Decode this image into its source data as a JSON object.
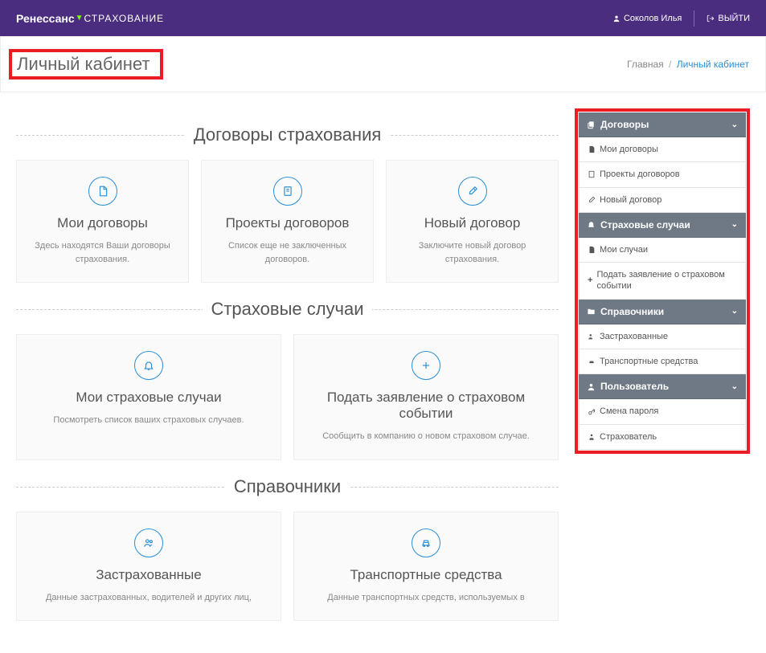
{
  "header": {
    "logo_bold": "Ренессанс",
    "logo_thin": "СТРАХОВАНИЕ",
    "user_name": "Соколов Илья",
    "logout": "ВЫЙТИ"
  },
  "page": {
    "title": "Личный кабинет",
    "breadcrumb_home": "Главная",
    "breadcrumb_current": "Личный кабинет"
  },
  "sections": {
    "contracts": {
      "title": "Договоры страхования",
      "cards": [
        {
          "title": "Мои договоры",
          "desc": "Здесь находятся Ваши договоры страхования."
        },
        {
          "title": "Проекты договоров",
          "desc": "Список еще не заключенных договоров."
        },
        {
          "title": "Новый договор",
          "desc": "Заключите новый договор страхования."
        }
      ]
    },
    "cases": {
      "title": "Страховые случаи",
      "cards": [
        {
          "title": "Мои страховые случаи",
          "desc": "Посмотреть список ваших страховых случаев."
        },
        {
          "title": "Подать заявление о страховом событии",
          "desc": "Сообщить в компанию о новом страховом случае."
        }
      ]
    },
    "references": {
      "title": "Справочники",
      "cards": [
        {
          "title": "Застрахованные",
          "desc": "Данные застрахованных, водителей и других лиц,"
        },
        {
          "title": "Транспортные средства",
          "desc": "Данные транспортных средств, используемых в"
        }
      ]
    }
  },
  "sidebar": {
    "groups": [
      {
        "title": "Договоры",
        "items": [
          "Мои договоры",
          "Проекты договоров",
          "Новый договор"
        ]
      },
      {
        "title": "Страховые случаи",
        "items": [
          "Мои случаи",
          "Подать заявление о страховом событии"
        ]
      },
      {
        "title": "Справочники",
        "items": [
          "Застрахованные",
          "Транспортные средства"
        ]
      },
      {
        "title": "Пользователь",
        "items": [
          "Смена пароля",
          "Страхователь"
        ]
      }
    ]
  }
}
